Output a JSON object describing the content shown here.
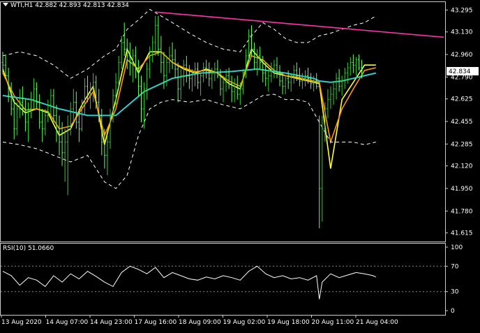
{
  "header": {
    "symbol": "WTI,H1",
    "open": "42.882",
    "high": "42.893",
    "low": "42.813",
    "close": "42.834"
  },
  "rsi_header": {
    "name": "RSI(10)",
    "value": "51.0660"
  },
  "current_price": "42.834",
  "colors": {
    "background": "#000000",
    "frame": "#cccccc",
    "bull_bar": "#33cc33",
    "bear_bar": "#66ff66",
    "ema_fast": "#ffff33",
    "ema_mid": "#ff9900",
    "ema_slow": "#33cccc",
    "bands": "#ffffff",
    "trendline": "#ff33aa",
    "rsi_line": "#ffffff",
    "price_label_bg": "#ffffff",
    "price_label_fg": "#000000"
  },
  "chart_data": [
    {
      "type": "line",
      "panel": "price",
      "ylim": [
        41.55,
        43.36
      ],
      "yticks": [
        "43.295",
        "43.130",
        "42.960",
        "42.790",
        "42.625",
        "42.455",
        "42.285",
        "42.120",
        "41.950",
        "41.780",
        "41.615"
      ],
      "xticks": [
        "13 Aug 2020",
        "14 Aug 07:00",
        "14 Aug 23:00",
        "17 Aug 16:00",
        "18 Aug 09:00",
        "19 Aug 02:00",
        "19 Aug 18:00",
        "20 Aug 11:00",
        "21 Aug 04:00"
      ],
      "grid": false,
      "bar_range": [
        0,
        156
      ],
      "bars": [
        [
          42.9,
          42.98,
          42.82,
          42.88
        ],
        [
          42.88,
          42.95,
          42.78,
          42.8
        ],
        [
          42.8,
          42.86,
          42.6,
          42.66
        ],
        [
          42.66,
          42.75,
          42.5,
          42.55
        ],
        [
          42.55,
          42.62,
          42.32,
          42.4
        ],
        [
          42.4,
          42.6,
          42.35,
          42.55
        ],
        [
          42.55,
          42.7,
          42.48,
          42.6
        ],
        [
          42.6,
          42.72,
          42.5,
          42.55
        ],
        [
          42.55,
          42.62,
          42.38,
          42.45
        ],
        [
          42.45,
          42.6,
          42.3,
          42.55
        ],
        [
          42.55,
          42.68,
          42.48,
          42.62
        ],
        [
          42.62,
          42.78,
          42.55,
          42.7
        ],
        [
          42.7,
          42.75,
          42.55,
          42.6
        ],
        [
          42.6,
          42.66,
          42.4,
          42.45
        ],
        [
          42.45,
          42.55,
          42.3,
          42.4
        ],
        [
          42.4,
          42.55,
          42.35,
          42.5
        ],
        [
          42.5,
          42.62,
          42.45,
          42.58
        ],
        [
          42.58,
          42.7,
          42.5,
          42.65
        ],
        [
          42.65,
          42.7,
          42.45,
          42.5
        ],
        [
          42.5,
          42.58,
          42.3,
          42.38
        ],
        [
          42.38,
          42.5,
          42.2,
          42.3
        ],
        [
          42.3,
          42.45,
          42.12,
          42.22
        ],
        [
          42.22,
          42.4,
          42.0,
          42.3
        ],
        [
          42.3,
          42.5,
          41.9,
          42.42
        ],
        [
          42.42,
          42.6,
          42.35,
          42.55
        ],
        [
          42.55,
          42.7,
          42.45,
          42.6
        ],
        [
          42.6,
          42.68,
          42.4,
          42.45
        ],
        [
          42.45,
          42.55,
          42.3,
          42.4
        ],
        [
          42.4,
          42.62,
          42.38,
          42.58
        ],
        [
          42.58,
          42.78,
          42.5,
          42.72
        ],
        [
          42.72,
          42.8,
          42.6,
          42.65
        ],
        [
          42.65,
          42.75,
          42.55,
          42.7
        ],
        [
          42.7,
          42.82,
          42.6,
          42.75
        ],
        [
          42.75,
          42.8,
          42.55,
          42.6
        ],
        [
          42.6,
          42.7,
          42.45,
          42.5
        ],
        [
          42.5,
          42.55,
          42.2,
          42.3
        ],
        [
          42.3,
          42.4,
          42.1,
          42.2
        ],
        [
          42.2,
          42.35,
          42.05,
          42.3
        ],
        [
          42.3,
          42.55,
          42.25,
          42.5
        ],
        [
          42.5,
          42.7,
          42.45,
          42.65
        ],
        [
          42.65,
          42.82,
          42.58,
          42.75
        ],
        [
          42.75,
          42.95,
          42.7,
          42.9
        ],
        [
          42.9,
          43.1,
          42.85,
          43.05
        ],
        [
          43.05,
          43.2,
          42.95,
          43.0
        ],
        [
          43.0,
          43.08,
          42.85,
          42.95
        ],
        [
          42.95,
          43.05,
          42.8,
          42.9
        ],
        [
          42.9,
          43.0,
          42.75,
          42.95
        ],
        [
          42.95,
          43.02,
          42.78,
          42.85
        ],
        [
          42.85,
          42.92,
          42.65,
          42.72
        ],
        [
          42.72,
          42.8,
          42.45,
          42.55
        ],
        [
          42.55,
          42.75,
          42.4,
          42.7
        ],
        [
          42.7,
          42.9,
          42.62,
          42.85
        ],
        [
          42.85,
          43.02,
          42.78,
          42.98
        ],
        [
          42.98,
          43.1,
          42.9,
          43.05
        ],
        [
          43.05,
          43.25,
          42.95,
          43.18
        ],
        [
          43.18,
          43.25,
          42.95,
          43.0
        ],
        [
          43.0,
          43.1,
          42.82,
          42.9
        ],
        [
          42.9,
          42.98,
          42.7,
          42.8
        ],
        [
          42.8,
          42.95,
          42.72,
          42.9
        ],
        [
          42.9,
          43.02,
          42.82,
          42.95
        ],
        [
          42.95,
          43.05,
          42.85,
          42.92
        ],
        [
          42.92,
          43.0,
          42.78,
          42.85
        ],
        [
          42.85,
          42.9,
          42.6,
          42.7
        ],
        [
          42.7,
          42.85,
          42.62,
          42.8
        ],
        [
          42.8,
          42.92,
          42.72,
          42.88
        ],
        [
          42.88,
          42.95,
          42.75,
          42.8
        ],
        [
          42.8,
          42.88,
          42.7,
          42.78
        ],
        [
          42.78,
          42.85,
          42.68,
          42.82
        ],
        [
          42.82,
          42.9,
          42.72,
          42.85
        ],
        [
          42.85,
          42.9,
          42.7,
          42.75
        ],
        [
          42.75,
          42.82,
          42.65,
          42.8
        ],
        [
          42.8,
          42.9,
          42.75,
          42.86
        ],
        [
          42.86,
          42.92,
          42.78,
          42.84
        ],
        [
          42.84,
          42.9,
          42.72,
          42.78
        ],
        [
          42.78,
          42.86,
          42.7,
          42.82
        ],
        [
          42.82,
          42.9,
          42.76,
          42.85
        ],
        [
          42.85,
          42.92,
          42.78,
          42.8
        ],
        [
          42.8,
          42.85,
          42.65,
          42.7
        ],
        [
          42.7,
          42.8,
          42.6,
          42.75
        ],
        [
          42.75,
          42.85,
          42.68,
          42.8
        ],
        [
          42.8,
          42.86,
          42.7,
          42.74
        ],
        [
          42.74,
          42.8,
          42.6,
          42.68
        ],
        [
          42.68,
          42.78,
          42.6,
          42.72
        ],
        [
          42.72,
          42.8,
          42.62,
          42.66
        ],
        [
          42.66,
          42.75,
          42.58,
          42.7
        ],
        [
          42.7,
          42.85,
          42.66,
          42.82
        ],
        [
          42.82,
          43.0,
          42.78,
          42.95
        ],
        [
          42.95,
          43.15,
          42.9,
          43.1
        ],
        [
          43.1,
          43.18,
          42.95,
          43.0
        ],
        [
          43.0,
          43.05,
          42.85,
          42.9
        ],
        [
          42.9,
          43.0,
          42.8,
          42.95
        ],
        [
          42.95,
          43.02,
          42.85,
          42.9
        ],
        [
          42.9,
          42.95,
          42.75,
          42.82
        ],
        [
          42.82,
          42.9,
          42.72,
          42.78
        ],
        [
          42.78,
          42.85,
          42.68,
          42.8
        ],
        [
          42.8,
          42.9,
          42.75,
          42.85
        ],
        [
          42.85,
          42.92,
          42.78,
          42.88
        ],
        [
          42.88,
          42.94,
          42.78,
          42.82
        ],
        [
          42.82,
          42.88,
          42.72,
          42.76
        ],
        [
          42.76,
          42.82,
          42.66,
          42.72
        ],
        [
          42.72,
          42.8,
          42.66,
          42.78
        ],
        [
          42.78,
          42.84,
          42.7,
          42.75
        ],
        [
          42.75,
          42.82,
          42.68,
          42.8
        ],
        [
          42.8,
          42.88,
          42.74,
          42.84
        ],
        [
          42.84,
          42.9,
          42.76,
          42.8
        ],
        [
          42.8,
          42.86,
          42.72,
          42.76
        ],
        [
          42.76,
          42.82,
          42.7,
          42.78
        ],
        [
          42.78,
          42.84,
          42.72,
          42.8
        ],
        [
          42.8,
          42.86,
          42.74,
          42.78
        ],
        [
          42.78,
          42.82,
          42.7,
          42.74
        ],
        [
          42.74,
          42.8,
          42.68,
          42.76
        ],
        [
          42.76,
          42.82,
          42.7,
          42.72
        ],
        [
          42.72,
          42.5,
          41.65,
          41.95
        ],
        [
          41.95,
          42.5,
          41.7,
          42.4
        ],
        [
          42.4,
          42.6,
          42.3,
          42.55
        ],
        [
          42.55,
          42.7,
          42.48,
          42.62
        ],
        [
          42.62,
          42.72,
          42.55,
          42.66
        ],
        [
          42.66,
          42.76,
          42.58,
          42.7
        ],
        [
          42.7,
          42.82,
          42.62,
          42.78
        ],
        [
          42.78,
          42.85,
          42.68,
          42.72
        ],
        [
          42.72,
          42.8,
          42.65,
          42.76
        ],
        [
          42.76,
          42.86,
          42.7,
          42.82
        ],
        [
          42.82,
          42.9,
          42.74,
          42.86
        ],
        [
          42.86,
          42.94,
          42.8,
          42.9
        ],
        [
          42.9,
          42.96,
          42.82,
          42.88
        ],
        [
          42.88,
          42.94,
          42.8,
          42.92
        ],
        [
          42.92,
          42.96,
          42.84,
          42.86
        ],
        [
          42.86,
          42.92,
          42.78,
          42.84
        ]
      ],
      "series": [
        {
          "style": "ema_fast",
          "x": [
            0,
            4,
            8,
            12,
            16,
            20,
            24,
            28,
            32,
            36,
            40,
            44,
            48,
            52,
            56,
            60,
            64,
            68,
            72,
            76,
            80,
            84,
            88,
            92,
            96,
            100,
            104,
            108,
            112,
            116,
            120,
            124,
            128,
            132
          ],
          "values": [
            42.85,
            42.6,
            42.52,
            42.55,
            42.52,
            42.35,
            42.4,
            42.58,
            42.72,
            42.28,
            42.62,
            43.0,
            42.82,
            42.98,
            42.98,
            42.9,
            42.85,
            42.82,
            42.85,
            42.82,
            42.74,
            42.7,
            43.0,
            42.9,
            42.82,
            42.8,
            42.78,
            42.76,
            42.74,
            42.1,
            42.62,
            42.75,
            42.88,
            42.88
          ]
        },
        {
          "style": "ema_mid",
          "x": [
            0,
            4,
            8,
            12,
            16,
            20,
            24,
            28,
            32,
            36,
            40,
            44,
            48,
            52,
            56,
            60,
            64,
            68,
            72,
            76,
            80,
            84,
            88,
            92,
            96,
            100,
            104,
            108,
            112,
            116,
            120,
            124,
            128,
            132
          ],
          "values": [
            42.82,
            42.65,
            42.54,
            42.55,
            42.53,
            42.4,
            42.42,
            42.55,
            42.68,
            42.35,
            42.55,
            42.92,
            42.85,
            42.95,
            42.98,
            42.9,
            42.86,
            42.83,
            42.84,
            42.82,
            42.76,
            42.72,
            42.95,
            42.92,
            42.84,
            42.8,
            42.79,
            42.77,
            42.75,
            42.3,
            42.55,
            42.7,
            42.84,
            42.86
          ]
        },
        {
          "style": "ema_slow",
          "x": [
            0,
            10,
            20,
            30,
            40,
            50,
            60,
            70,
            80,
            90,
            100,
            110,
            112,
            116,
            120,
            124,
            128,
            132
          ],
          "values": [
            42.65,
            42.62,
            42.55,
            42.5,
            42.5,
            42.68,
            42.78,
            42.82,
            42.83,
            42.85,
            42.82,
            42.78,
            42.76,
            42.75,
            42.76,
            42.78,
            42.8,
            42.82
          ]
        },
        {
          "style": "bands",
          "x": [
            0,
            6,
            12,
            18,
            24,
            30,
            36,
            40,
            44,
            48,
            52,
            56,
            60,
            66,
            72,
            78,
            84,
            88,
            92,
            96,
            100,
            104,
            108,
            112,
            116,
            120,
            124,
            128,
            132
          ],
          "values": [
            42.95,
            42.98,
            42.95,
            42.88,
            42.78,
            42.85,
            42.95,
            43.0,
            43.15,
            43.22,
            43.3,
            43.25,
            43.2,
            43.12,
            43.05,
            43.0,
            42.98,
            43.1,
            43.2,
            43.15,
            43.08,
            43.05,
            43.05,
            43.1,
            43.12,
            43.15,
            43.18,
            43.2,
            43.25
          ]
        },
        {
          "style": "bands",
          "x": [
            0,
            6,
            12,
            18,
            24,
            30,
            36,
            40,
            44,
            48,
            52,
            56,
            60,
            66,
            72,
            78,
            84,
            88,
            92,
            96,
            100,
            104,
            108,
            112,
            116,
            120,
            124,
            128,
            132
          ],
          "values": [
            42.3,
            42.28,
            42.25,
            42.2,
            42.15,
            42.2,
            42.0,
            41.95,
            42.05,
            42.35,
            42.55,
            42.6,
            42.62,
            42.6,
            42.62,
            42.58,
            42.55,
            42.6,
            42.65,
            42.66,
            42.62,
            42.62,
            42.6,
            42.45,
            42.3,
            42.3,
            42.3,
            42.28,
            42.3
          ]
        },
        {
          "style": "trendline",
          "x": [
            54,
            156
          ],
          "values": [
            43.28,
            43.09
          ]
        }
      ]
    },
    {
      "type": "line",
      "panel": "rsi",
      "title": "RSI(10)",
      "ylim": [
        0,
        100
      ],
      "yticks": [
        "100",
        "70",
        "30",
        "0"
      ],
      "levels": [
        70,
        30
      ],
      "x": [
        0,
        3,
        6,
        9,
        12,
        15,
        18,
        21,
        24,
        27,
        30,
        33,
        36,
        39,
        42,
        45,
        48,
        51,
        54,
        57,
        60,
        63,
        66,
        69,
        72,
        75,
        78,
        81,
        84,
        87,
        90,
        93,
        96,
        99,
        102,
        105,
        108,
        111,
        112,
        113,
        116,
        119,
        122,
        125,
        128,
        131,
        132
      ],
      "values": [
        62,
        55,
        40,
        52,
        48,
        38,
        55,
        45,
        58,
        50,
        62,
        54,
        45,
        38,
        60,
        70,
        65,
        58,
        68,
        52,
        60,
        55,
        50,
        48,
        53,
        50,
        55,
        52,
        48,
        62,
        70,
        58,
        52,
        55,
        50,
        52,
        48,
        55,
        18,
        45,
        58,
        52,
        56,
        60,
        58,
        55,
        53
      ]
    }
  ]
}
